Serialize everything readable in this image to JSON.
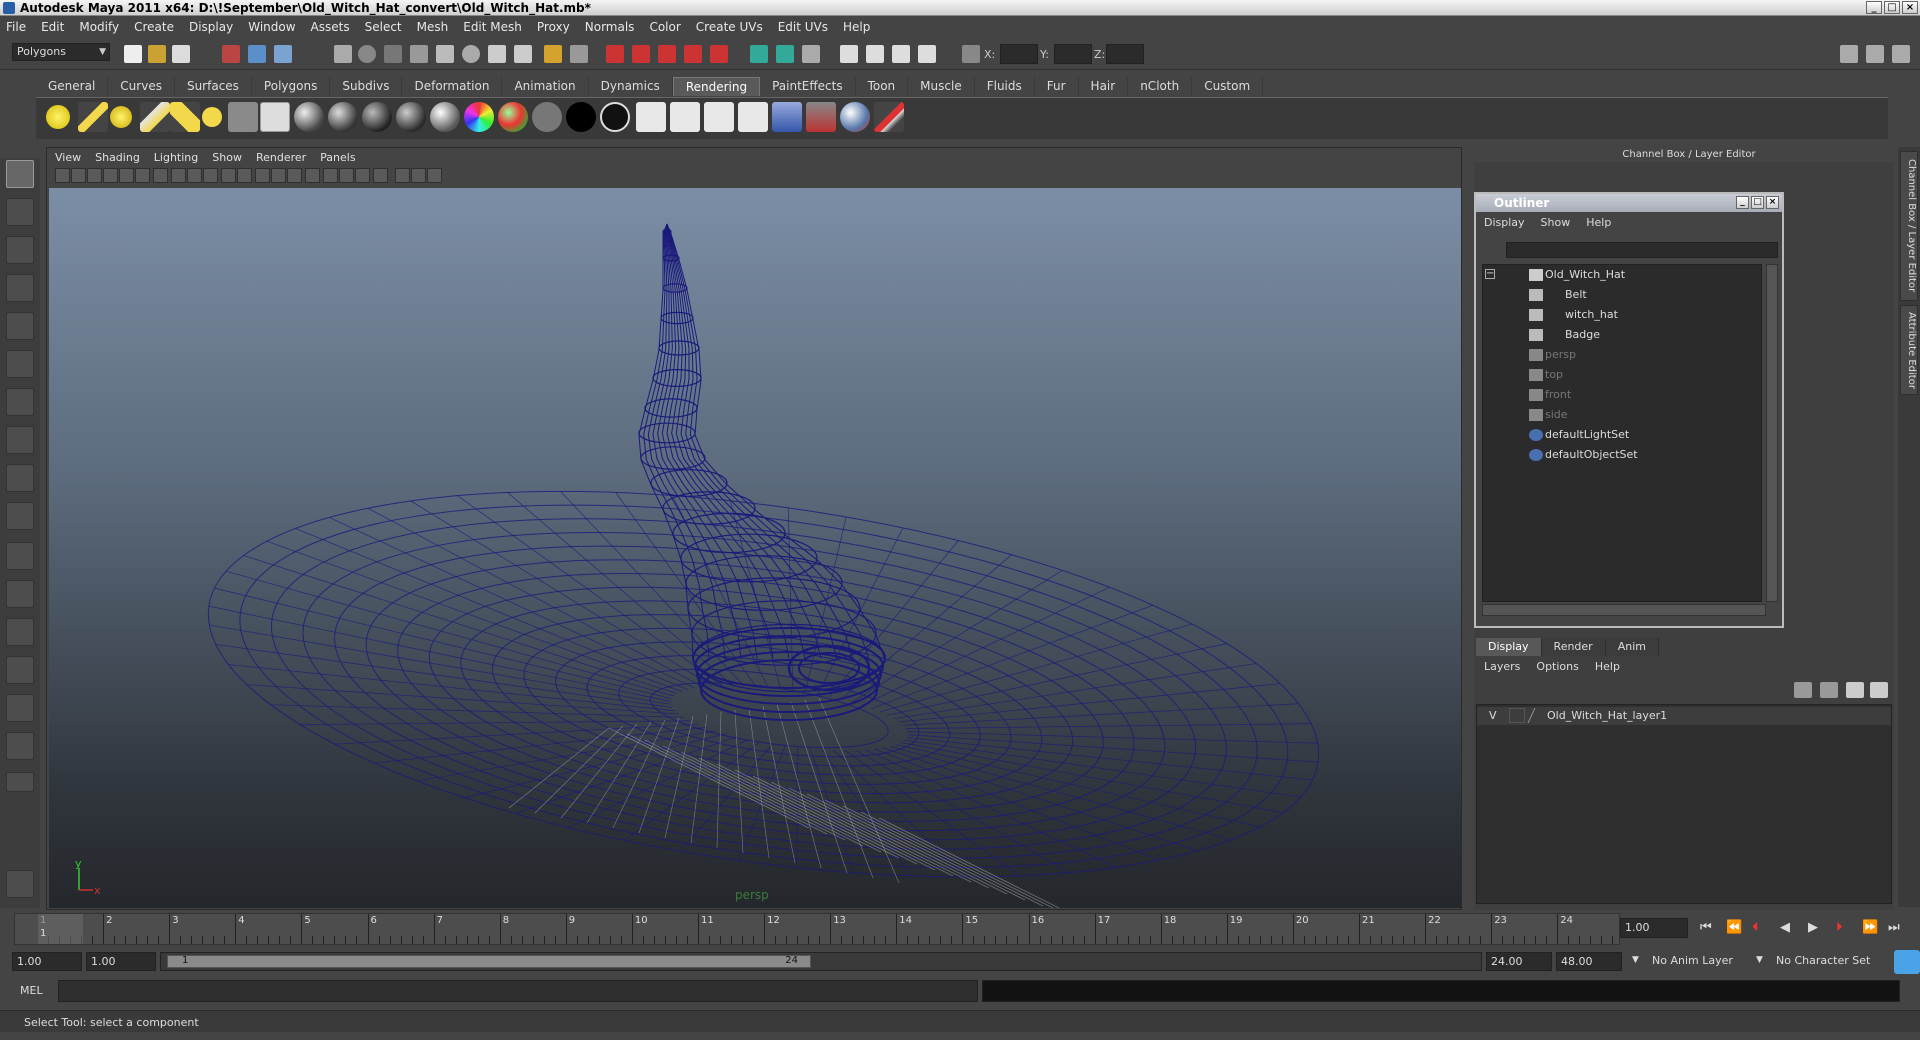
{
  "window": {
    "title": "Autodesk Maya 2011 x64: D:\\!September\\Old_Witch_Hat_convert\\Old_Witch_Hat.mb*"
  },
  "menubar": [
    "File",
    "Edit",
    "Modify",
    "Create",
    "Display",
    "Window",
    "Assets",
    "Select",
    "Mesh",
    "Edit Mesh",
    "Proxy",
    "Normals",
    "Color",
    "Create UVs",
    "Edit UVs",
    "Help"
  ],
  "statusline": {
    "mode": "Polygons",
    "x_label": "X:",
    "y_label": "Y:",
    "z_label": "Z:"
  },
  "shelf": {
    "tabs": [
      "General",
      "Curves",
      "Surfaces",
      "Polygons",
      "Subdivs",
      "Deformation",
      "Animation",
      "Dynamics",
      "Rendering",
      "PaintEffects",
      "Toon",
      "Muscle",
      "Fluids",
      "Fur",
      "Hair",
      "nCloth",
      "Custom"
    ],
    "active_tab": "Rendering"
  },
  "viewport": {
    "menu": [
      "View",
      "Shading",
      "Lighting",
      "Show",
      "Renderer",
      "Panels"
    ],
    "camera": "persp",
    "axis_y": "y",
    "axis_x": "x",
    "wire_color": "#1a1a7a"
  },
  "channelbox": {
    "title": "Channel Box / Layer Editor"
  },
  "outliner": {
    "title": "Outliner",
    "menu": [
      "Display",
      "Show",
      "Help"
    ],
    "items": [
      {
        "label": "Old_Witch_Hat",
        "dim": false
      },
      {
        "label": "Belt",
        "dim": false
      },
      {
        "label": "witch_hat",
        "dim": false
      },
      {
        "label": "Badge",
        "dim": false
      },
      {
        "label": "persp",
        "dim": true
      },
      {
        "label": "top",
        "dim": true
      },
      {
        "label": "front",
        "dim": true
      },
      {
        "label": "side",
        "dim": true
      },
      {
        "label": "defaultLightSet",
        "dim": false
      },
      {
        "label": "defaultObjectSet",
        "dim": false
      }
    ]
  },
  "layer_editor": {
    "tabs": [
      "Display",
      "Render",
      "Anim"
    ],
    "menu": [
      "Layers",
      "Options",
      "Help"
    ],
    "layer": {
      "visible": "V",
      "name": "Old_Witch_Hat_layer1"
    }
  },
  "side_tabs": [
    "Channel Box / Layer Editor",
    "Attribute Editor"
  ],
  "timeslider": {
    "ticks": [
      "1",
      "2",
      "3",
      "4",
      "5",
      "6",
      "7",
      "8",
      "9",
      "10",
      "11",
      "12",
      "13",
      "14",
      "15",
      "16",
      "17",
      "18",
      "19",
      "20",
      "21",
      "22",
      "23",
      "24"
    ],
    "current_marker": "1",
    "current_frame": "1.00"
  },
  "range": {
    "start": "1.00",
    "playback_start": "1.00",
    "thumb_start": "1",
    "thumb_end": "24",
    "playback_end": "24.00",
    "end": "48.00",
    "anim_layer": "No Anim Layer",
    "char_set": "No Character Set"
  },
  "cmdline": {
    "label": "MEL"
  },
  "helpline": {
    "text": "Select Tool: select a component"
  }
}
